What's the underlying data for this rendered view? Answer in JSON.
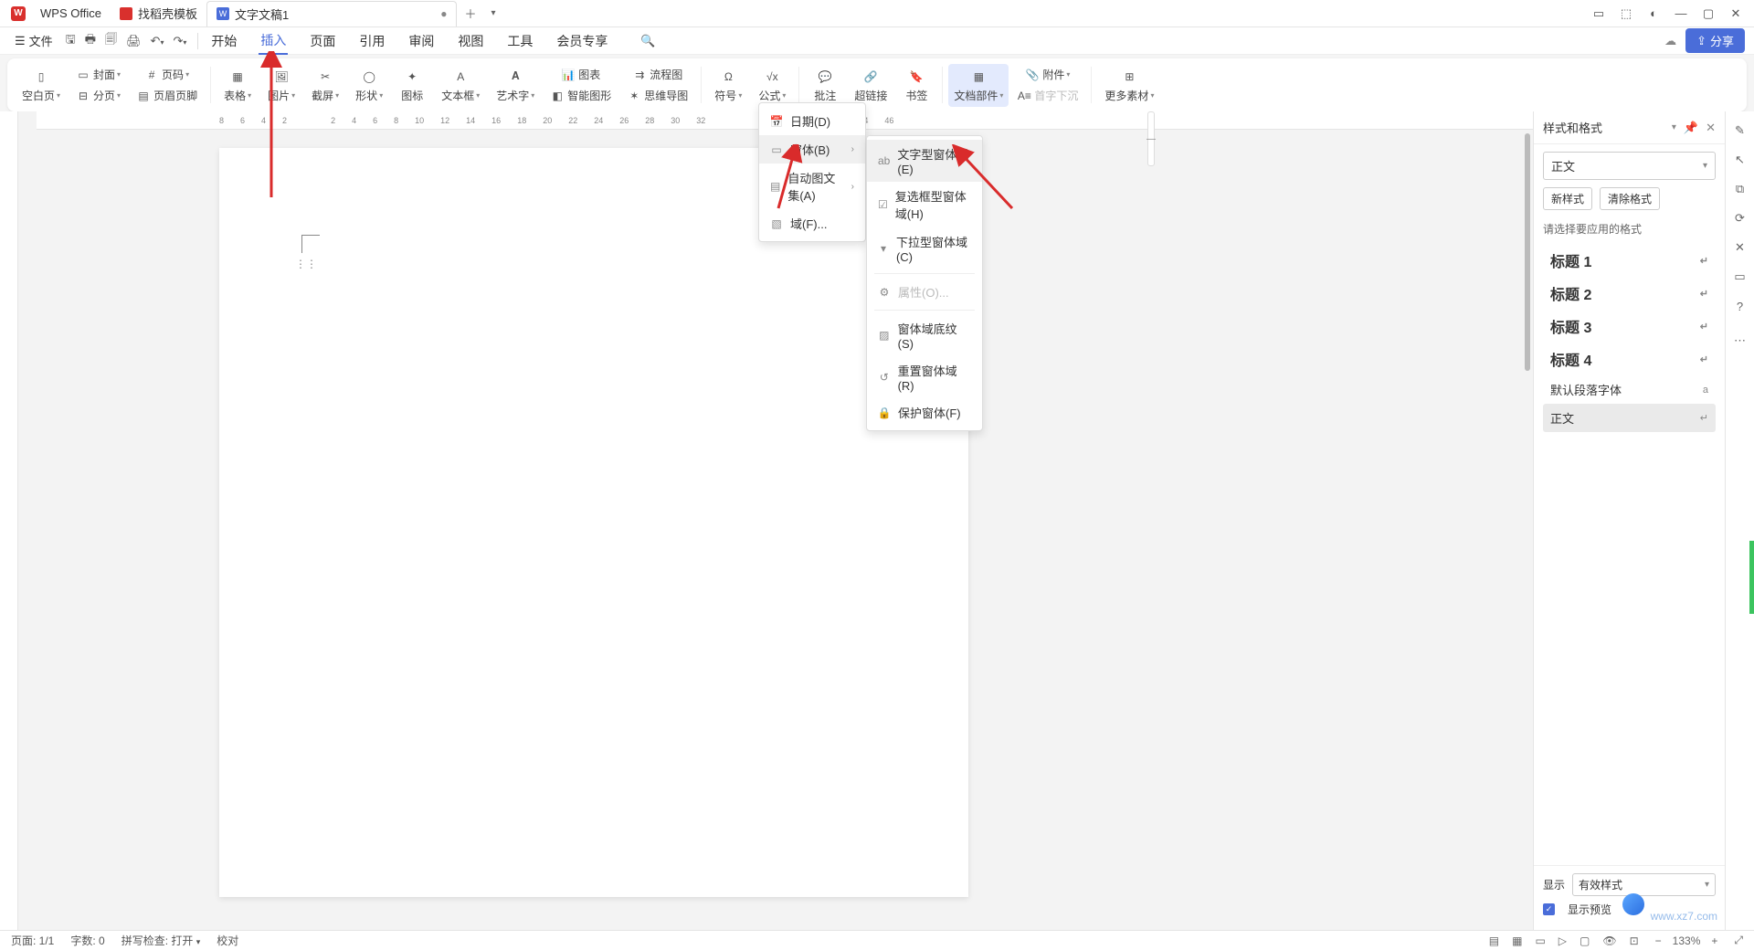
{
  "titlebar": {
    "app_name": "WPS Office",
    "tab1": "找稻壳模板",
    "tab2": "文字文稿1"
  },
  "menubar": {
    "file": "文件",
    "items": [
      "开始",
      "插入",
      "页面",
      "引用",
      "审阅",
      "视图",
      "工具",
      "会员专享"
    ],
    "share": "分享"
  },
  "ribbon": {
    "blank_page": "空白页",
    "cover": "封面",
    "page_number": "页码",
    "page_break": "分页",
    "header_footer": "页眉页脚",
    "table": "表格",
    "picture": "图片",
    "screenshot": "截屏",
    "shape": "形状",
    "icon": "图标",
    "textbox": "文本框",
    "wordart": "艺术字",
    "chart": "图表",
    "smart_graphic": "智能图形",
    "flowchart": "流程图",
    "mindmap": "思维导图",
    "symbol": "符号",
    "formula": "公式",
    "comment": "批注",
    "hyperlink": "超链接",
    "bookmark": "书签",
    "doc_parts": "文档部件",
    "attachment": "附件",
    "dropcap": "首字下沉",
    "resources": "更多素材"
  },
  "dropdown1": {
    "date": "日期(D)",
    "form": "窗体(B)",
    "autotext": "自动图文集(A)",
    "field": "域(F)..."
  },
  "dropdown2": {
    "text_form": "文字型窗体域(E)",
    "checkbox_form": "复选框型窗体域(H)",
    "dropdown_form": "下拉型窗体域(C)",
    "properties": "属性(O)...",
    "shading": "窗体域底纹(S)",
    "reset": "重置窗体域(R)",
    "protect": "保护窗体(F)"
  },
  "ruler_h": [
    "8",
    "6",
    "4",
    "2",
    "2",
    "4",
    "6",
    "8",
    "10",
    "12",
    "14",
    "16",
    "18",
    "20",
    "22",
    "24",
    "26",
    "28",
    "30",
    "32",
    "44",
    "46"
  ],
  "sidebar": {
    "title": "样式和格式",
    "current": "正文",
    "new_style": "新样式",
    "clear_format": "清除格式",
    "prompt": "请选择要应用的格式",
    "styles": [
      "标题 1",
      "标题 2",
      "标题 3",
      "标题 4"
    ],
    "default_font": "默认段落字体",
    "body": "正文",
    "display": "显示",
    "effective": "有效样式",
    "preview": "显示预览"
  },
  "statusbar": {
    "page": "页面: 1/1",
    "words": "字数: 0",
    "spell": "拼写检查: 打开",
    "proof": "校对",
    "zoom": "133%"
  },
  "watermark": {
    "text": "www.xz7.com"
  }
}
